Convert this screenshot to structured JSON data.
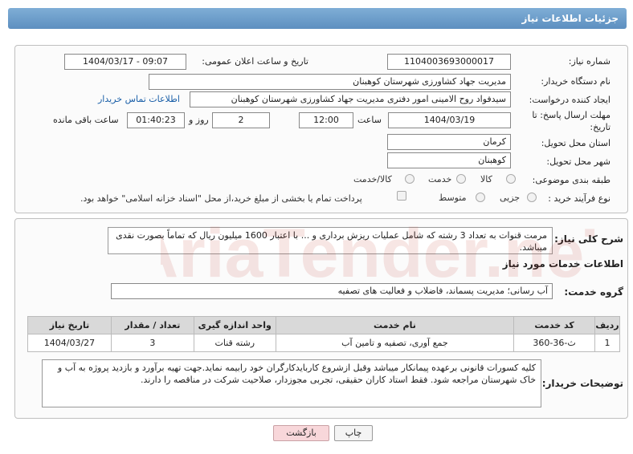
{
  "header": {
    "title": "جزئیات اطلاعات نیاز"
  },
  "form": {
    "need_number_label": "شماره نیاز:",
    "need_number": "1104003693000017",
    "announce_label": "تاریخ و ساعت اعلان عمومی:",
    "announce_value": "1404/03/17 - 09:07",
    "buyer_org_label": "نام دستگاه خریدار:",
    "buyer_org": "مدیریت جهاد کشاورزی شهرستان کوهبنان",
    "creator_label": "ایجاد کننده درخواست:",
    "creator": "سیدفواد روح الامینی امور دفتری مدیریت جهاد کشاورزی شهرستان کوهبنان",
    "contact_link": "اطلاعات تماس خریدار",
    "deadline_label_1": "مهلت ارسال پاسخ: تا",
    "deadline_label_2": "تاریخ:",
    "deadline_date": "1404/03/19",
    "time_label": "ساعت",
    "deadline_time": "12:00",
    "days_value": "2",
    "days_label": "روز و",
    "remaining_time": "01:40:23",
    "remaining_label": "ساعت باقی مانده",
    "province_label": "استان محل تحویل:",
    "province": "کرمان",
    "city_label": "شهر محل تحویل:",
    "city": "کوهبنان",
    "category_label": "طبقه بندی موضوعی:",
    "category_options": [
      "کالا",
      "خدمت",
      "کالا/خدمت"
    ],
    "process_label": "نوع فرآیند خرید :",
    "process_options": [
      "جزیی",
      "متوسط"
    ],
    "payment_note": "پرداخت تمام یا بخشی از مبلغ خرید،از محل \"اسناد خزانه اسلامی\" خواهد بود."
  },
  "summary": {
    "label": "شرح کلی نیاز:",
    "text": "مرمت قنوات  به تعداد 3 رشته که  شامل عملیات ریزش برداری و ... با اعتبار 1600 میلیون ریال که تماماً بصورت نقدی میباشد."
  },
  "services": {
    "section_title": "اطلاعات خدمات مورد نیاز",
    "group_label": "گروه خدمت:",
    "group_value": "آب رسانی؛ مدیریت پسماند، فاضلاب و فعالیت های تصفیه",
    "columns": [
      "ردیف",
      "کد خدمت",
      "نام خدمت",
      "واحد اندازه گیری",
      "تعداد / مقدار",
      "تاریخ نیاز"
    ],
    "rows": [
      [
        "1",
        "ث-36-360",
        "جمع آوری، تصفیه و تامین آب",
        "رشته قنات",
        "3",
        "1404/03/27"
      ]
    ]
  },
  "buyer_notes": {
    "label": "توضیحات خریدار:",
    "text": "کلیه کسورات قانونی برعهده پیمانکار میباشد وقبل ازشروع کاربایدکارگران خود رابیمه نماید.جهت تهیه برآورد و بازدید پروژه به آب و خاک شهرستان مراجعه شود. فقط استاد کاران حقیقی، تجربی مجوزدار، صلاحیت شرکت در مناقصه را دارند."
  },
  "buttons": {
    "print": "چاپ",
    "back": "بازگشت"
  },
  "watermark": {
    "text": "AriaTender.neT"
  },
  "colors": {
    "header_blue": "#6b9bca",
    "link_blue": "#1a5fa8",
    "back_button": "#f8d7da",
    "watermark_red": "#c0392b"
  }
}
